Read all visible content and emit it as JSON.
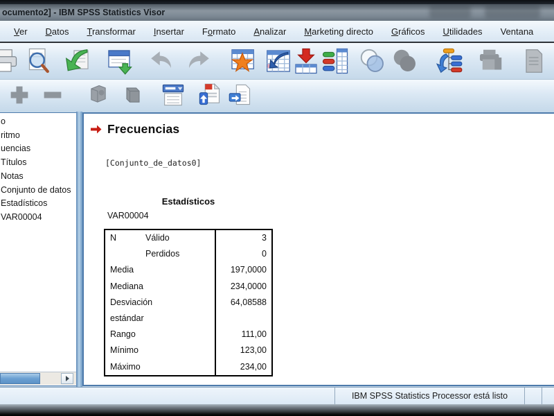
{
  "window": {
    "title": "ocumento2] - IBM SPSS Statistics Visor"
  },
  "menu": {
    "items": [
      {
        "label": "Ver",
        "underline": 0
      },
      {
        "label": "Datos",
        "underline": 0
      },
      {
        "label": "Transformar",
        "underline": 0
      },
      {
        "label": "Insertar",
        "underline": 0
      },
      {
        "label": "Formato",
        "underline": 1
      },
      {
        "label": "Analizar",
        "underline": 0
      },
      {
        "label": "Marketing directo",
        "underline": 0
      },
      {
        "label": "Gráficos",
        "underline": 0
      },
      {
        "label": "Utilidades",
        "underline": 0
      },
      {
        "label": "Ventana",
        "underline": -1
      }
    ]
  },
  "toolbar_main": {
    "icons": [
      "print",
      "print-preview",
      "export",
      "recall-dialogs",
      "undo",
      "redo",
      "designate-window",
      "goto-data",
      "goto-case",
      "variables",
      "use-variable-sets",
      "use-variable-sets-disabled",
      "results-tree",
      "disabled-tool-1",
      "disabled-tool-2"
    ]
  },
  "toolbar_outline": {
    "icons": [
      "expand",
      "collapse",
      "show",
      "hide",
      "insert-heading",
      "insert-title",
      "insert-text"
    ]
  },
  "outline_tree": {
    "items": [
      "o",
      "ritmo",
      "uencias",
      "Títulos",
      "Notas",
      "Conjunto de datos",
      "Estadísticos",
      "VAR00004"
    ]
  },
  "content": {
    "heading": "Frecuencias",
    "dataset_line": "[Conjunto_de_datos0]",
    "table": {
      "title": "Estadísticos",
      "variable": "VAR00004",
      "rows": [
        {
          "label": "N",
          "sublabel": "Válido",
          "value": "3"
        },
        {
          "label": "",
          "sublabel": "Perdidos",
          "value": "0"
        },
        {
          "label": "Media",
          "sublabel": "",
          "value": "197,0000"
        },
        {
          "label": "Mediana",
          "sublabel": "",
          "value": "234,0000"
        },
        {
          "label": "Desviación estándar",
          "sublabel": "",
          "value": "64,08588"
        },
        {
          "label": "Rango",
          "sublabel": "",
          "value": "111,00"
        },
        {
          "label": "Mínimo",
          "sublabel": "",
          "value": "123,00"
        },
        {
          "label": "Máximo",
          "sublabel": "",
          "value": "234,00"
        }
      ]
    }
  },
  "status_bar": {
    "message": "IBM SPSS Statistics Processor está listo"
  },
  "colors": {
    "heading_arrow": "#c81e14",
    "titlebar": "#7e8a95",
    "toolbar": "#dbe8f4",
    "panel_border": "#4d7aab",
    "table_border": "#000000",
    "status_bg": "#e4eef8"
  }
}
